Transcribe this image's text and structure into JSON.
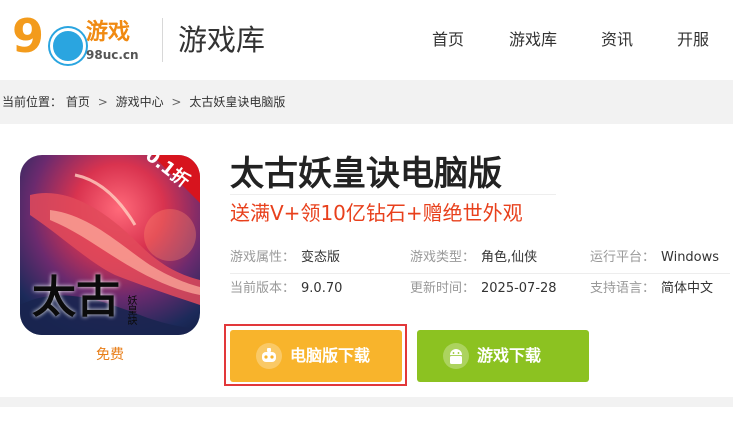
{
  "header": {
    "logo_text": "游戏",
    "logo_url": "98uc.cn",
    "section_title": "游戏库",
    "nav": [
      "首页",
      "游戏库",
      "资讯",
      "开服"
    ]
  },
  "breadcrumb": {
    "prefix": "当前位置：",
    "items": [
      "首页",
      "游戏中心",
      "太古妖皇诀电脑版"
    ],
    "separator": ">"
  },
  "game": {
    "cover": {
      "badge": "0.1折",
      "title_art": "太古",
      "subtitle_art": "妖皇訣"
    },
    "price": "免费",
    "title": "太古妖皇诀电脑版",
    "promo": "送满V+领10亿钻石+赠绝世外观",
    "info": [
      [
        {
          "label": "游戏属性：",
          "value": "变态版"
        },
        {
          "label": "游戏类型：",
          "value": "角色,仙侠"
        },
        {
          "label": "运行平台：",
          "value": "Windows"
        }
      ],
      [
        {
          "label": "当前版本：",
          "value": "9.0.70"
        },
        {
          "label": "更新时间：",
          "value": "2025-07-28"
        },
        {
          "label": "支持语言：",
          "value": "简体中文"
        }
      ]
    ],
    "buttons": {
      "pc_download": "电脑版下载",
      "game_download": "游戏下载"
    }
  },
  "colors": {
    "accent_orange": "#f8b42c",
    "accent_green": "#8cc221",
    "promo_red": "#e8401c",
    "highlight_border": "#e2383a"
  }
}
